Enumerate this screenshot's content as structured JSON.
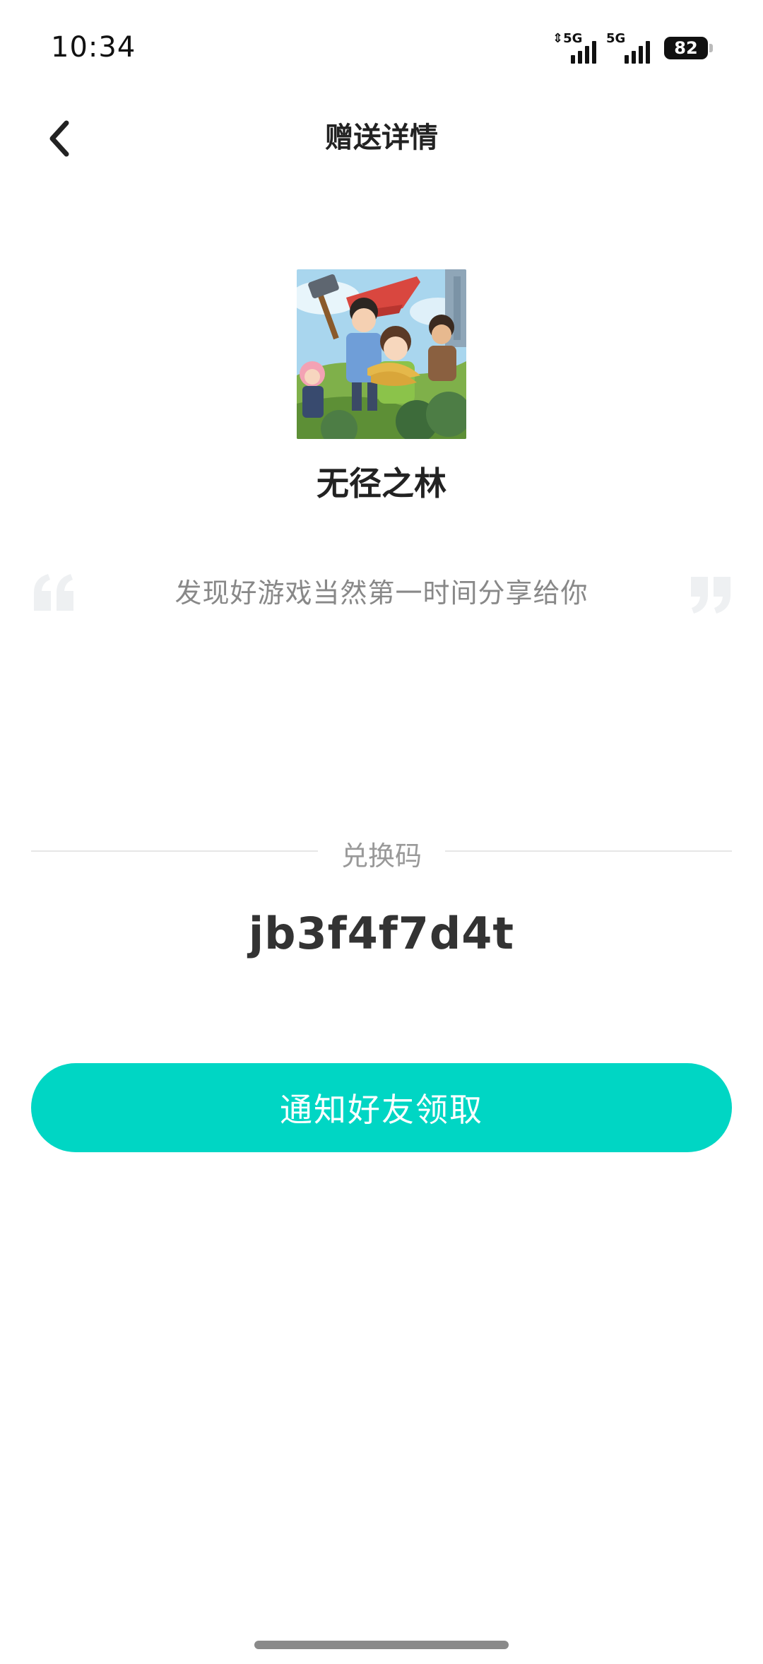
{
  "status_bar": {
    "time": "10:34",
    "signal_1_label": "5G",
    "signal_2_label": "5G",
    "battery": "82"
  },
  "header": {
    "title": "赠送详情",
    "back_icon": "chevron-left-icon"
  },
  "game": {
    "name": "无径之林",
    "cover_alt": "game-cover-art"
  },
  "share_message": "发现好游戏当然第一时间分享给你",
  "redeem": {
    "label": "兑换码",
    "code": "jb3f4f7d4t"
  },
  "action": {
    "notify_label": "通知好友领取"
  },
  "colors": {
    "accent": "#00d6c4",
    "quote_mark": "#eef0f2",
    "title_text": "#222222",
    "muted_text": "#888888"
  }
}
